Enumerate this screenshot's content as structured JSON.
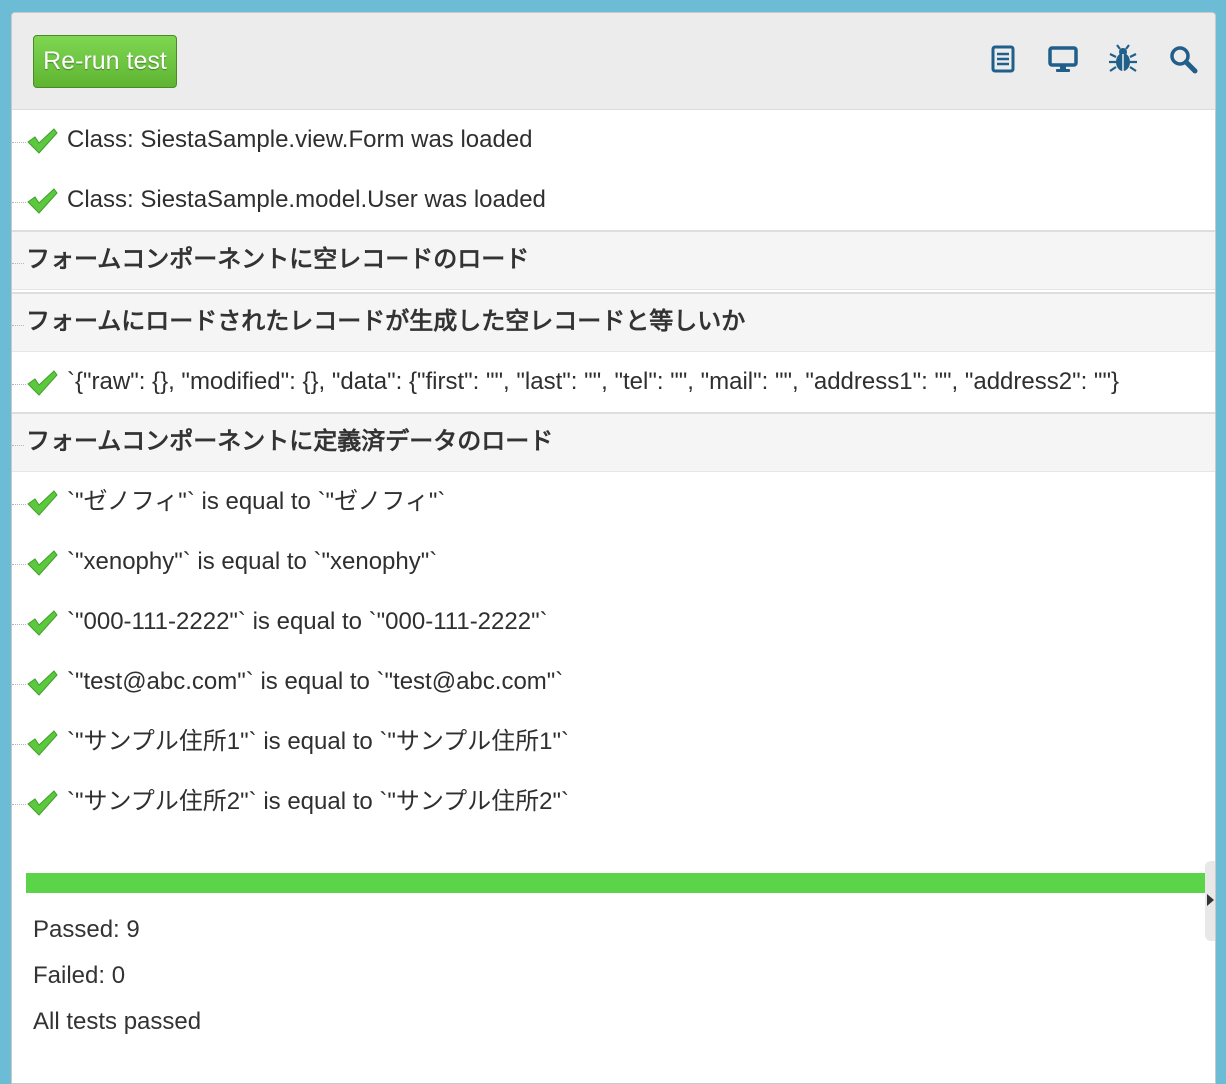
{
  "toolbar": {
    "rerun_label": "Re-run test",
    "icons": [
      "document-icon",
      "monitor-icon",
      "bug-icon",
      "search-icon"
    ],
    "icon_color": "#1f5f8a"
  },
  "results": [
    {
      "kind": "assert",
      "text": "Class: SiestaSample.view.Form was loaded"
    },
    {
      "kind": "assert",
      "text": "Class: SiestaSample.model.User was loaded"
    },
    {
      "kind": "group",
      "text": "フォームコンポーネントに空レコードのロード"
    },
    {
      "kind": "group",
      "text": "フォームにロードされたレコードが生成した空レコードと等しいか"
    },
    {
      "kind": "assert",
      "text": "`{\"raw\": {}, \"modified\": {}, \"data\": {\"first\": \"\", \"last\": \"\", \"tel\": \"\", \"mail\": \"\", \"address1\": \"\", \"address2\": \"\"}"
    },
    {
      "kind": "group",
      "text": "フォームコンポーネントに定義済データのロード"
    },
    {
      "kind": "assert",
      "text": "`\"ゼノフィ\"` is equal to `\"ゼノフィ\"`"
    },
    {
      "kind": "assert",
      "text": "`\"xenophy\"` is equal to `\"xenophy\"`"
    },
    {
      "kind": "assert",
      "text": "`\"000-111-2222\"` is equal to `\"000-111-2222\"`"
    },
    {
      "kind": "assert",
      "text": "`\"test@abc.com\"` is equal to `\"test@abc.com\"`"
    },
    {
      "kind": "assert",
      "text": "`\"サンプル住所1\"` is equal to `\"サンプル住所1\"`"
    },
    {
      "kind": "assert",
      "text": "`\"サンプル住所2\"` is equal to `\"サンプル住所2\"`"
    }
  ],
  "progress": {
    "passed_fraction": 1.0,
    "color": "#5bd44a"
  },
  "summary": {
    "passed": "Passed: 9",
    "failed": "Failed: 0",
    "status": "All tests passed"
  },
  "colors": {
    "rerun_button": "#6cc43f",
    "check": "#5cc83e",
    "background": "#6bbcd4"
  }
}
